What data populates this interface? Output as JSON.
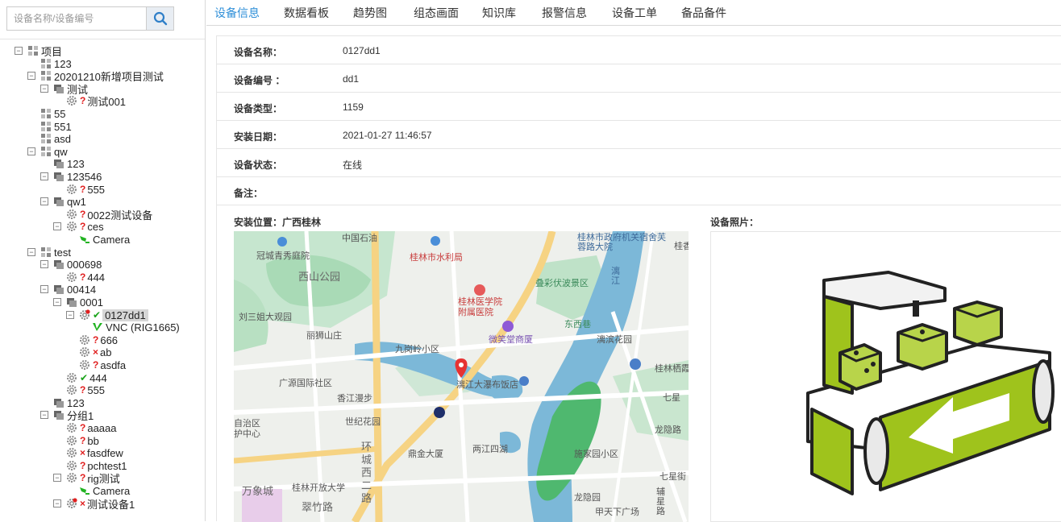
{
  "search": {
    "placeholder": "设备名称/设备编号"
  },
  "tree": [
    {
      "label": "项目",
      "depth": 0,
      "toggle": "-",
      "icon": "group"
    },
    {
      "label": "123",
      "depth": 1,
      "toggle": "",
      "icon": "group"
    },
    {
      "label": "20201210新增项目测试",
      "depth": 1,
      "toggle": "-",
      "icon": "group"
    },
    {
      "label": "测试",
      "depth": 2,
      "toggle": "-",
      "icon": "folder"
    },
    {
      "label": "测试001",
      "depth": 3,
      "toggle": "",
      "icon": "gear",
      "status": "?"
    },
    {
      "label": "55",
      "depth": 1,
      "toggle": "",
      "icon": "group"
    },
    {
      "label": "551",
      "depth": 1,
      "toggle": "",
      "icon": "group"
    },
    {
      "label": "asd",
      "depth": 1,
      "toggle": "",
      "icon": "group"
    },
    {
      "label": "qw",
      "depth": 1,
      "toggle": "-",
      "icon": "group"
    },
    {
      "label": "123",
      "depth": 2,
      "toggle": "",
      "icon": "folder"
    },
    {
      "label": "123546",
      "depth": 2,
      "toggle": "-",
      "icon": "folder"
    },
    {
      "label": "555",
      "depth": 3,
      "toggle": "",
      "icon": "gear",
      "status": "?"
    },
    {
      "label": "qw1",
      "depth": 2,
      "toggle": "-",
      "icon": "folder"
    },
    {
      "label": "0022测试设备",
      "depth": 3,
      "toggle": "",
      "icon": "gear",
      "status": "?"
    },
    {
      "label": "ces",
      "depth": 3,
      "toggle": "-",
      "icon": "gear",
      "status": "?"
    },
    {
      "label": "Camera",
      "depth": 4,
      "toggle": "",
      "icon": "camera"
    },
    {
      "label": "test",
      "depth": 1,
      "toggle": "-",
      "icon": "group"
    },
    {
      "label": "000698",
      "depth": 2,
      "toggle": "-",
      "icon": "folder"
    },
    {
      "label": "444",
      "depth": 3,
      "toggle": "",
      "icon": "gear",
      "status": "?"
    },
    {
      "label": "00414",
      "depth": 2,
      "toggle": "-",
      "icon": "folder"
    },
    {
      "label": "0001",
      "depth": 3,
      "toggle": "-",
      "icon": "folder"
    },
    {
      "label": "0127dd1",
      "depth": 4,
      "toggle": "-",
      "icon": "gear-red",
      "status": "ok",
      "selected": true
    },
    {
      "label": "VNC (RIG1665)",
      "depth": 5,
      "toggle": "",
      "icon": "vnc"
    },
    {
      "label": "666",
      "depth": 4,
      "toggle": "",
      "icon": "gear",
      "status": "?"
    },
    {
      "label": "ab",
      "depth": 4,
      "toggle": "",
      "icon": "gear",
      "status": "x"
    },
    {
      "label": "asdfa",
      "depth": 4,
      "toggle": "",
      "icon": "gear",
      "status": "?"
    },
    {
      "label": "444",
      "depth": 3,
      "toggle": "",
      "icon": "gear",
      "status": "ok"
    },
    {
      "label": "555",
      "depth": 3,
      "toggle": "",
      "icon": "gear",
      "status": "?"
    },
    {
      "label": "123",
      "depth": 2,
      "toggle": "",
      "icon": "folder"
    },
    {
      "label": "分组1",
      "depth": 2,
      "toggle": "-",
      "icon": "folder"
    },
    {
      "label": "aaaaa",
      "depth": 3,
      "toggle": "",
      "icon": "gear",
      "status": "?"
    },
    {
      "label": "bb",
      "depth": 3,
      "toggle": "",
      "icon": "gear",
      "status": "?"
    },
    {
      "label": "fasdfew",
      "depth": 3,
      "toggle": "",
      "icon": "gear",
      "status": "x"
    },
    {
      "label": "pchtest1",
      "depth": 3,
      "toggle": "",
      "icon": "gear",
      "status": "?"
    },
    {
      "label": "rig测试",
      "depth": 3,
      "toggle": "-",
      "icon": "gear",
      "status": "?"
    },
    {
      "label": "Camera",
      "depth": 4,
      "toggle": "",
      "icon": "camera"
    },
    {
      "label": "测试设备1",
      "depth": 3,
      "toggle": "-",
      "icon": "gear-red",
      "status": "x"
    }
  ],
  "tabs": [
    "设备信息",
    "数据看板",
    "趋势图",
    "组态画面",
    "知识库",
    "报警信息",
    "设备工单",
    "备品备件"
  ],
  "active_tab": 0,
  "info": {
    "name_label": "设备名称：",
    "name": "0127dd1",
    "code_label": "设备编号 ：",
    "code": "dd1",
    "type_label": "设备类型：",
    "type": "1159",
    "date_label": "安装日期：",
    "date": "2021-01-27 11:46:57",
    "status_label": "设备状态：",
    "status": "在线",
    "remark_label": "备注：",
    "remark": "",
    "location_label": "安装位置：",
    "location": "广西桂林",
    "photo_label": "设备照片："
  },
  "map_labels": [
    "中国石油",
    "桂林市水利局",
    "桂林市政府机关宿舍芙蓉路大院",
    "桂香",
    "冠城青秀庭院",
    "西山公园",
    "叠彩伏波景区",
    "漓江",
    "桂林医学院附属医院",
    "刘三姐大观园",
    "东西巷",
    "丽狮山庄",
    "微笑堂商厦",
    "漓滨花园",
    "九岗岭小区",
    "桂林栖霞",
    "漓江大瀑布饭店",
    "广源国际社区",
    "香江漫步",
    "七星",
    "世纪花园",
    "自治区",
    "护中心",
    "龙隐路",
    "两江四湖",
    "施家园小区",
    "鼎金大厦",
    "环城西二路",
    "七星街",
    "桂林开放大学",
    "龙隐园",
    "辅星路",
    "万象城",
    "翠竹路",
    "甲天下广场"
  ],
  "colors": {
    "accent": "#2f8fd8",
    "green": "#9fc31c",
    "water": "#7cb8d8",
    "park": "#a5d6b0",
    "road": "#f6d383"
  }
}
